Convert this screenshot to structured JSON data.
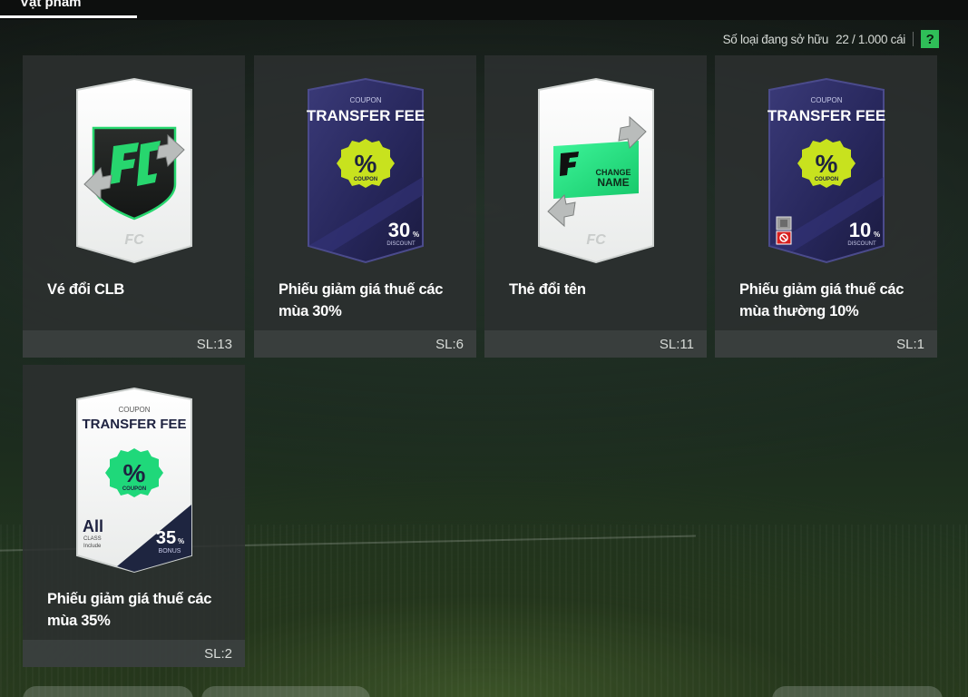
{
  "tab": {
    "label": "Vật phẩm"
  },
  "inventory": {
    "label": "Số loại đang sở hữu",
    "value": "22 / 1.000 cái",
    "help_symbol": "?"
  },
  "card_text": {
    "coupon": "COUPON",
    "transfer_fee": "TRANSFER FEE",
    "percent_symbol": "%",
    "discount": "DISCOUNT",
    "bonus": "BONUS",
    "change": "CHANGE",
    "name": "NAME",
    "all": "All",
    "class": "CLASS",
    "include": "Include",
    "logo_mark": "FC"
  },
  "items": [
    {
      "name": "Vé đổi CLB",
      "qty": "SL:13",
      "art": "club-transfer-ticket"
    },
    {
      "name": "Phiếu giảm giá thuế các mùa 30%",
      "qty": "SL:6",
      "art": "transfer-fee-coupon-dark",
      "badge": "30",
      "badge_caption": "DISCOUNT"
    },
    {
      "name": "Thẻ đổi tên",
      "qty": "SL:11",
      "art": "name-change-card"
    },
    {
      "name": "Phiếu giảm giá thuế các mùa thường 10%",
      "qty": "SL:1",
      "art": "transfer-fee-coupon-dark-locked",
      "badge": "10",
      "badge_caption": "DISCOUNT"
    },
    {
      "name": "Phiếu giảm giá thuế các mùa 35%",
      "qty": "SL:2",
      "art": "transfer-fee-coupon-light",
      "badge": "35",
      "badge_caption": "BONUS"
    }
  ],
  "colors": {
    "accent_green": "#2fbe58",
    "coupon_yellow": "#c8e21e",
    "coupon_green": "#1fd87a",
    "card_navy": "#2a2a5c"
  }
}
